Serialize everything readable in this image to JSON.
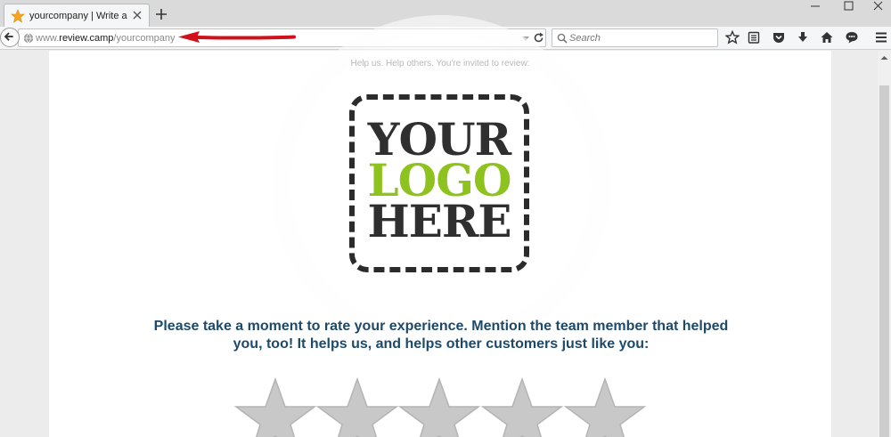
{
  "browser": {
    "tab": {
      "title": "yourcompany | Write a Re..."
    },
    "url": {
      "prefix": "www.",
      "domain": "review.camp",
      "path": "/yourcompany"
    },
    "search": {
      "placeholder": "Search"
    }
  },
  "page": {
    "invite_text": "Help us. Help others. You're invited to review:",
    "logo": {
      "line1": "YOUR",
      "line2": "LOGO",
      "line3": "HERE"
    },
    "prompt": "Please take a moment to rate your experience. Mention the team member that helped you, too! It helps us, and helps other customers just like you:",
    "rating": {
      "max_stars": 5,
      "selected": 0
    }
  },
  "colors": {
    "prompt_text": "#1d4a6b",
    "logo_green": "#8ec31f",
    "logo_dark": "#2f2f2f",
    "star_fill": "#c8c8c8",
    "annotation_arrow": "#d0111b"
  },
  "icons": [
    "star-favicon",
    "close-icon",
    "plus-icon",
    "minimize-icon",
    "maximize-icon",
    "window-close-icon",
    "back-arrow-icon",
    "globe-icon",
    "dropdown-icon",
    "reload-icon",
    "search-icon",
    "bookmark-star-icon",
    "reading-list-icon",
    "pocket-icon",
    "download-icon",
    "home-icon",
    "chat-icon",
    "menu-icon"
  ]
}
